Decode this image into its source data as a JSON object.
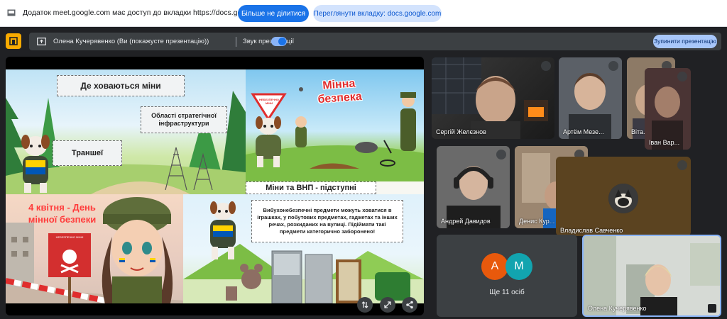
{
  "share_bar": {
    "message": "Додаток meet.google.com має доступ до вкладки https://docs.google.com",
    "stop_sharing": "Більше не ділитися",
    "view_tab": "Переглянути вкладку: docs.google.com"
  },
  "presentation_bar": {
    "presenter": "Олена Кучерявенко (Ви (покажусте презентацію))",
    "sound_label": "Звук презентації",
    "stop_button": "Зупинити презентацію"
  },
  "slide": {
    "box_where": "Де ховаються міни",
    "box_infra": "Області стратегічної інфраструктури",
    "box_trench": "Траншеї",
    "title_safety_line1": "Мінна",
    "title_safety_line2": "безпека",
    "sign_text": "НЕБЕЗПЕЧНО МІНИ",
    "heading_insidious": "Міни та ВНП - підступні",
    "banner_line1": "4 квітня - День",
    "banner_line2": "мінної безпеки",
    "warning_text": "Вибухонебезпечні предмети можуть ховатися в іграшках, у побутових предметах, гаджетах та інших речах, розкиданих на вулиці. Підіймати такі предмети категорично заборонено!"
  },
  "participants": [
    {
      "name": "Сергій Желєзнов"
    },
    {
      "name": "Артём Мезе..."
    },
    {
      "name": "Віта..."
    },
    {
      "name": "Іван Вар..."
    },
    {
      "name": "Андрей Давидов"
    },
    {
      "name": "Денис Кур..."
    },
    {
      "name": "Владислав Савченко"
    },
    {
      "name": "Олена Кучерявенко"
    }
  ],
  "others": {
    "avatar_a": "A",
    "avatar_m": "M",
    "label": "Ще 11 осіб"
  },
  "colors": {
    "accent_blue": "#1a73e8",
    "meet_bg": "#202124",
    "bar_bg": "#3c4043",
    "avatar_a_bg": "#e8590c",
    "avatar_m_bg": "#12a4af"
  }
}
